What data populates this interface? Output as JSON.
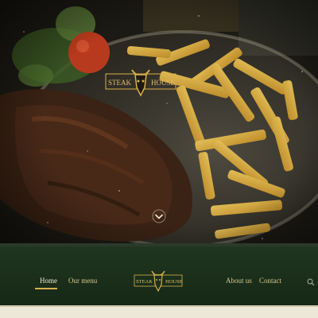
{
  "brand": {
    "logo_line_left": "STEAK",
    "logo_line_right": "HOUSE",
    "accent_color": "#d9b04a",
    "nav_background": "#1f331f"
  },
  "hero": {
    "scroll_icon": "chevron-down-icon"
  },
  "nav": {
    "items": [
      {
        "label": "Home",
        "active": true
      },
      {
        "label": "Our menu",
        "active": false
      },
      {
        "label": "About us",
        "active": false
      },
      {
        "label": "Contact",
        "active": false
      }
    ],
    "search_icon": "search-icon"
  }
}
